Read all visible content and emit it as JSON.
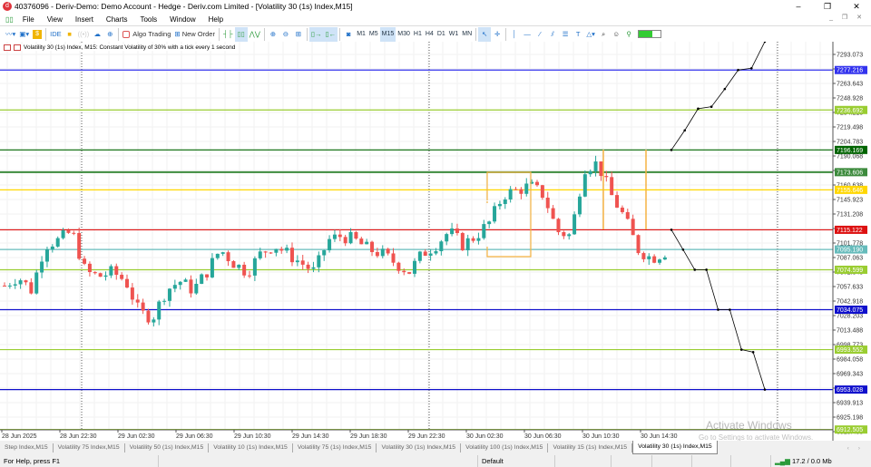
{
  "window": {
    "title": "40376096 - Deriv-Demo: Demo Account - Hedge - Deriv.com Limited - [Volatility 30 (1s) Index,M15]",
    "logo": "d",
    "minimize": "–",
    "restore": "❐",
    "close": "✕"
  },
  "menu": [
    "File",
    "View",
    "Insert",
    "Charts",
    "Tools",
    "Window",
    "Help"
  ],
  "toolbar": {
    "ide": "IDE",
    "algo_trading": "Algo Trading",
    "new_order": "New Order",
    "timeframes": [
      "M1",
      "M5",
      "M15",
      "M30",
      "H1",
      "H4",
      "D1",
      "W1",
      "MN"
    ],
    "selected_timeframe": "M15"
  },
  "chart": {
    "legend": "Volatility 30 (1s) Index, M15:  Constant Volatility of 30% with a tick every 1 second",
    "price_axis": [
      "7293.073",
      "7278.358",
      "7263.643",
      "7248.928",
      "7234.213",
      "7219.498",
      "7204.783",
      "7190.068",
      "7175.353",
      "7160.638",
      "7145.923",
      "7131.208",
      "7116.493",
      "7101.778",
      "7087.063",
      "7072.348",
      "7057.633",
      "7042.918",
      "7028.203",
      "7013.488",
      "6998.773",
      "6984.058",
      "6969.343",
      "6954.628",
      "6939.913",
      "6925.198",
      "6910.483"
    ],
    "time_axis": [
      "28 Jun 2025",
      "28 Jun 22:30",
      "29 Jun 02:30",
      "29 Jun 06:30",
      "29 Jun 10:30",
      "29 Jun 14:30",
      "29 Jun 18:30",
      "29 Jun 22:30",
      "30 Jun 02:30",
      "30 Jun 06:30",
      "30 Jun 10:30",
      "30 Jun 14:30"
    ],
    "levels": [
      {
        "price": 7277.216,
        "label": "7277.216",
        "color": "#3333ee"
      },
      {
        "price": 7236.692,
        "label": "7236.692",
        "color": "#9acd32"
      },
      {
        "price": 7196.169,
        "label": "7196.169",
        "color": "#006400"
      },
      {
        "price": 7173.606,
        "label": "7173.606",
        "color": "#3d8b3d"
      },
      {
        "price": 7155.646,
        "label": "7155.646",
        "color": "#ffd700"
      },
      {
        "price": 7115.122,
        "label": "7115.122",
        "color": "#dd1111"
      },
      {
        "price": 7095.19,
        "label": "7095.190",
        "color": "#66bbbb"
      },
      {
        "price": 7074.599,
        "label": "7074.599",
        "color": "#9acd32"
      },
      {
        "price": 7034.075,
        "label": "7034.075",
        "color": "#1010cc"
      },
      {
        "price": 6993.552,
        "label": "6993.552",
        "color": "#9acd32"
      },
      {
        "price": 6953.028,
        "label": "6953.028",
        "color": "#1010cc"
      },
      {
        "price": 6912.505,
        "label": "6912.505",
        "color": "#9acd32"
      }
    ],
    "price_path": [
      7058.5,
      7067.7,
      7053.9,
      7099.9,
      7104.5,
      7113.7,
      7072.3,
      7067.7,
      7072.3,
      7063.1,
      7030.9,
      7026.3,
      7053.9,
      7063.1,
      7053.9,
      7072.3,
      7095.3,
      7081.5,
      7072.3,
      7090.7,
      7099.9,
      7090.7,
      7081.5,
      7072.3,
      7104.5,
      7109.1,
      7104.5,
      7095.3,
      7090.7,
      7081.5,
      7072.3,
      7090.7,
      7099.9,
      7113.7,
      7099.9,
      7109.1,
      7122.9,
      7150.5,
      7155.1,
      7159.7,
      7150.5,
      7113.7,
      7109.1,
      7178.1,
      7182.7,
      7150.5,
      7127.5,
      7095.3,
      7086.1,
      7092.5
    ],
    "projection_up": [
      7196.169,
      7216,
      7238,
      7240,
      7258,
      7277.216,
      7279,
      7306
    ],
    "projection_down": [
      7115.122,
      7095,
      7074.599,
      7074.599,
      7034.075,
      7034.075,
      6993.552,
      6991,
      6953.028
    ],
    "colors": {
      "bull": "#26a69a",
      "bear": "#ef5350",
      "projection": "#000000",
      "box": "#f5b342"
    }
  },
  "tabs": [
    "Step Index,M15",
    "Volatility 75 Index,M15",
    "Volatility 50 (1s) Index,M15",
    "Volatility 10 (1s) Index,M15",
    "Volatility 75 (1s) Index,M15",
    "Volatility 30 (1s) Index,M15",
    "Volatility 100 (1s) Index,M15",
    "Volatility 15 (1s) Index,M15",
    "Volatility 30 (1s) Index,M15"
  ],
  "active_tab": 8,
  "status": {
    "help": "For Help, press F1",
    "profile": "Default",
    "traffic": "17.2 / 0.0 Mb"
  },
  "watermark": {
    "title": "Activate Windows",
    "subtitle": "Go to Settings to activate Windows."
  }
}
